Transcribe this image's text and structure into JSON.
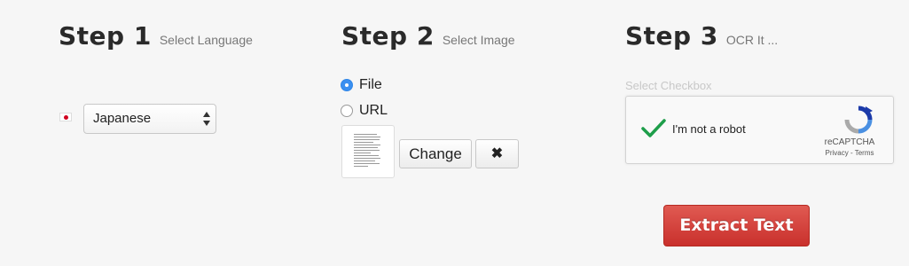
{
  "steps": [
    {
      "title": "Step 1",
      "subtitle": "Select Language"
    },
    {
      "title": "Step 2",
      "subtitle": "Select Image"
    },
    {
      "title": "Step 3",
      "subtitle": "OCR It ..."
    }
  ],
  "language": {
    "selected": "Japanese",
    "flag_icon": "japan-flag-icon"
  },
  "image_source": {
    "options": [
      {
        "label": "File",
        "checked": true
      },
      {
        "label": "URL",
        "checked": false
      }
    ],
    "change_label": "Change",
    "remove_icon": "✖"
  },
  "captcha": {
    "hint": "Select Checkbox",
    "label": "I'm not a robot",
    "brand": "reCAPTCHA",
    "terms": "Privacy - Terms"
  },
  "extract_label": "Extract Text",
  "colors": {
    "extract": "#c9302c",
    "radio_checked": "#3a8ff0",
    "checkmark": "#1e9e4a"
  }
}
